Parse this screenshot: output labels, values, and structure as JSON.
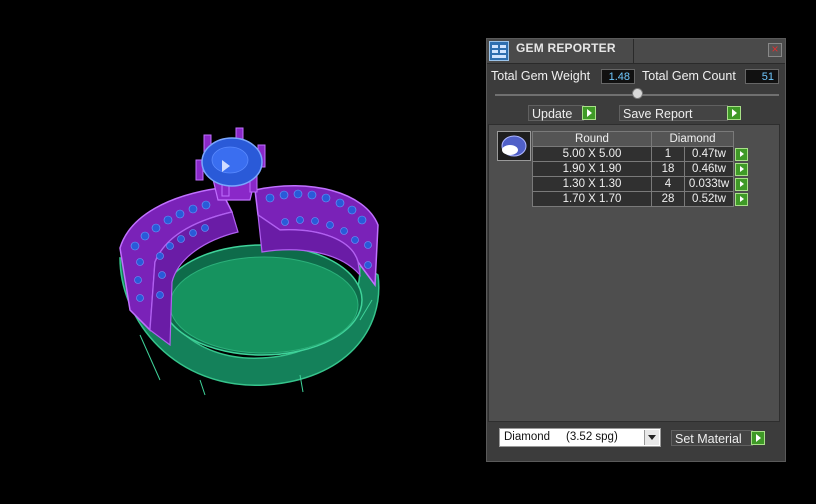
{
  "window": {
    "title": "GEM REPORTER",
    "close_label": "×"
  },
  "stats": {
    "total_weight_label": "Total Gem Weight",
    "total_weight_value": "1.48",
    "total_count_label": "Total Gem Count",
    "total_count_value": "51"
  },
  "slider": {
    "value_fraction": 0.5
  },
  "buttons": {
    "update": "Update",
    "save_report": "Save Report",
    "set_material": "Set Material"
  },
  "gem_table": {
    "shape": "Round",
    "material": "Diamond",
    "rows": [
      {
        "size": "5.00 X 5.00",
        "count": "1",
        "weight": "0.47tw"
      },
      {
        "size": "1.90 X 1.90",
        "count": "18",
        "weight": "0.46tw"
      },
      {
        "size": "1.30 X 1.30",
        "count": "4",
        "weight": "0.033tw"
      },
      {
        "size": "1.70 X 1.70",
        "count": "28",
        "weight": "0.52tw"
      }
    ]
  },
  "material_select": {
    "value": "Diamond     (3.52 spg)"
  },
  "colors": {
    "band_metal": "#8a28c8",
    "gems": "#2a5ad8",
    "inner_shank": "#14815a",
    "value_text": "#6fc8ff",
    "go_button": "#3f9a27"
  },
  "icons": {
    "app": "gem-reporter-app-icon",
    "gem_thumb": "round-gem-icon",
    "go": "play-arrow-icon"
  }
}
